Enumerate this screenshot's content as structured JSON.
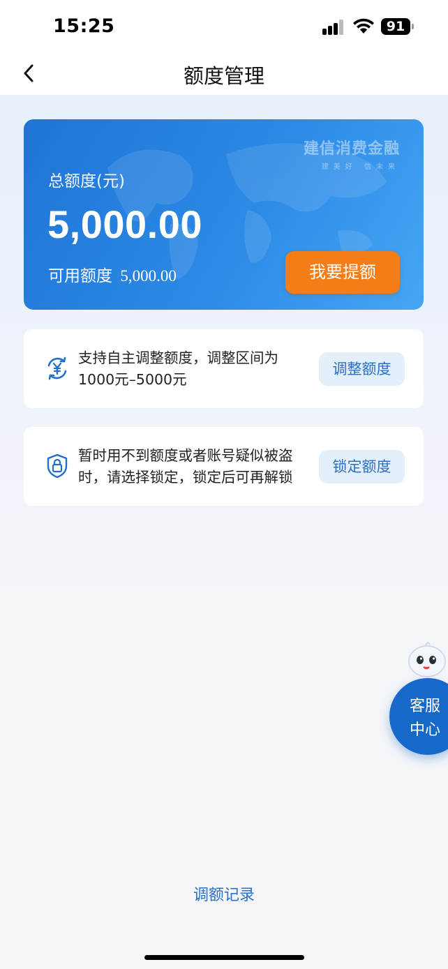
{
  "status_bar": {
    "time": "15:25",
    "battery": "91"
  },
  "nav": {
    "title": "额度管理"
  },
  "credit_card": {
    "brand": "建信消费金融",
    "slogan": "建美好 信未来",
    "total_label": "总额度(元)",
    "total_amount": "5,000.00",
    "available_label": "可用额度",
    "available_amount": "5,000.00",
    "raise_button": "我要提额"
  },
  "options": [
    {
      "description": "支持自主调整额度，调整区间为1000元–5000元",
      "button": "调整额度",
      "icon": "yen-cycle-icon"
    },
    {
      "description": "暂时用不到额度或者账号疑似被盗时，请选择锁定，锁定后可再解锁",
      "button": "锁定额度",
      "icon": "shield-lock-icon"
    }
  ],
  "customer_service": {
    "line1": "客服",
    "line2": "中心"
  },
  "records_link": "调额记录",
  "colors": {
    "card_blue": "#1f74d6",
    "accent_orange": "#f57d17",
    "link_blue": "#2a72c8"
  }
}
